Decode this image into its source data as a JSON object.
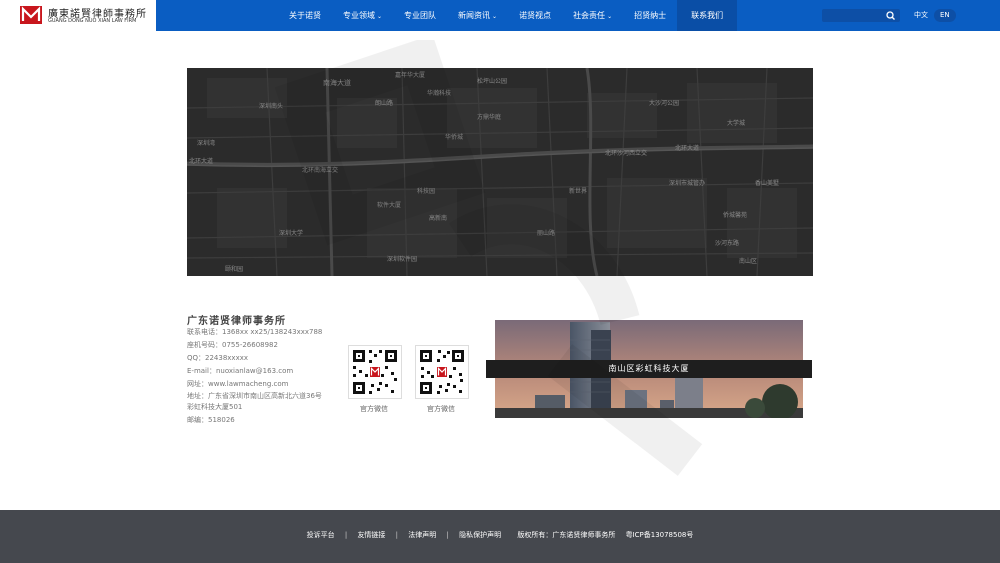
{
  "header": {
    "logo_cn": "廣東諾賢律師事務所",
    "logo_en": "GUANG DONG NUO XIAN LAW FIRM",
    "nav": [
      {
        "label": "关于诺贤",
        "caret": ""
      },
      {
        "label": "专业领域",
        "caret": "⌄"
      },
      {
        "label": "专业团队",
        "caret": ""
      },
      {
        "label": "新闻资讯",
        "caret": "⌄"
      },
      {
        "label": "诺贤视点",
        "caret": ""
      },
      {
        "label": "社会责任",
        "caret": "⌄"
      },
      {
        "label": "招贤纳士",
        "caret": ""
      },
      {
        "label": "联系我们",
        "caret": ""
      }
    ],
    "active_nav": "联系我们",
    "search_placeholder": "",
    "lang_cn": "中文",
    "lang_en": "EN"
  },
  "map": {
    "labels": [
      "南海大道",
      "嘉年华大厦",
      "松坪山公园",
      "华瀚科技",
      "朗山路",
      "深圳南头",
      "方鼎华庭",
      "北环大道",
      "北环南海立交",
      "北环沙河西立交",
      "科技园",
      "软件大厦",
      "深圳湾",
      "深圳大学",
      "高新南",
      "大沙河公园",
      "深圳市城管办",
      "深圳软件园",
      "丽山路",
      "沙河东路",
      "新世界",
      "华侨城",
      "香山美墅",
      "大学城",
      "南山区",
      "侨城馨苑",
      "颐和园",
      "北环大道"
    ]
  },
  "contact": {
    "firm_name": "广东诺贤律师事务所",
    "lines": [
      "联系电话：1368xx xx25/138243xxx788",
      "座机号码：0755-26608982",
      "QQ：22438xxxxx",
      "E-mail：nuoxianlaw@163.com",
      "网址：www.lawmacheng.com",
      "地址：广东省深圳市南山区高新北六道36号",
      "彩虹科技大厦501",
      "邮编：518026"
    ],
    "qr_labels": [
      "官方微信",
      "官方微信"
    ]
  },
  "building": {
    "caption": "南山区彩虹科技大厦"
  },
  "footer": {
    "links": [
      "投诉平台",
      "友情链接",
      "法律声明",
      "隐私保护声明"
    ],
    "copyright": "版权所有：广东诺贤律师事务所",
    "icp": "粤ICP备13078508号",
    "separator": "|"
  },
  "colors": {
    "brand_blue": "#0a5dc2",
    "footer_gray": "#45484e",
    "map_dark": "#2b2b2b",
    "logo_red": "#c8161d"
  }
}
